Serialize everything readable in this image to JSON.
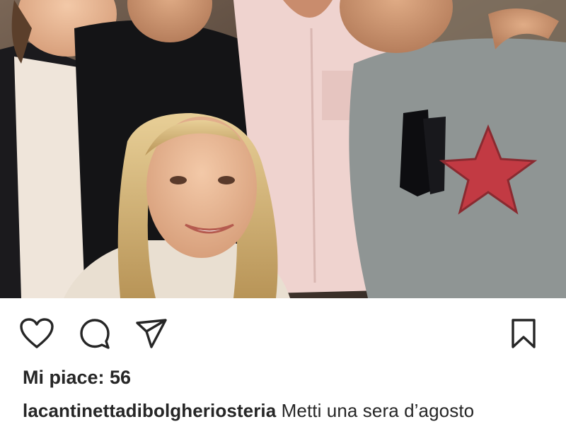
{
  "post": {
    "photo_alt": "",
    "likes_text": "Mi piace: 56",
    "caption": {
      "username": "lacantinettadibolgheriosteria",
      "text": "Metti una sera d’agosto"
    }
  },
  "actions": {
    "like_icon": "heart-icon",
    "comment_icon": "comment-icon",
    "share_icon": "paper-plane-icon",
    "save_icon": "bookmark-icon"
  },
  "colors": {
    "text": "#262626",
    "background": "#ffffff",
    "icon": "#262626"
  }
}
